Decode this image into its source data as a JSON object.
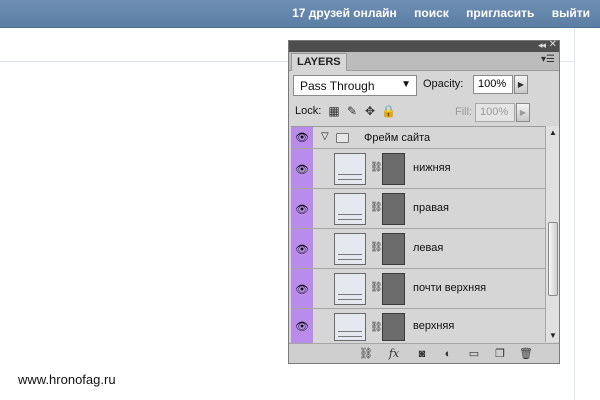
{
  "site_nav": {
    "friends_online": "17 друзей онлайн",
    "search": "поиск",
    "invite": "пригласить",
    "logout": "выйти"
  },
  "watermark": "www.hronofag.ru",
  "panel": {
    "tab_label": "LAYERS",
    "blend_mode": "Pass Through",
    "opacity_label": "Opacity:",
    "opacity_value": "100%",
    "lock_label": "Lock:",
    "fill_label": "Fill:",
    "fill_value": "100%",
    "group_name": "Фрейм сайта",
    "layers": [
      {
        "name": "нижняя"
      },
      {
        "name": "правая"
      },
      {
        "name": "левая"
      },
      {
        "name": "почти верхняя"
      },
      {
        "name": "верхняя"
      }
    ]
  },
  "colors": {
    "topbar": "#5b7ea4",
    "eye_column": "#b88ce8",
    "panel_bg": "#d6d6d6"
  }
}
